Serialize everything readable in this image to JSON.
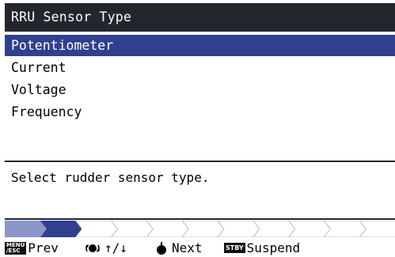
{
  "title": "RRU Sensor Type",
  "options": [
    {
      "label": "Potentiometer",
      "selected": true
    },
    {
      "label": "Current",
      "selected": false
    },
    {
      "label": "Voltage",
      "selected": false
    },
    {
      "label": "Frequency",
      "selected": false
    }
  ],
  "message": "Select rudder sensor type.",
  "progress": {
    "total_steps": 11,
    "current_step": 2
  },
  "footer": {
    "menu_badge_top": "MENU",
    "menu_badge_bottom": "/ESC",
    "prev_label": "Prev",
    "knob_label": "↑/↓",
    "next_label": "Next",
    "stby_badge": "STBY",
    "suspend_label": "Suspend"
  },
  "colors": {
    "title_bar": "#23262d",
    "selection": "#30408e",
    "progress_done_dark": "#30408e",
    "progress_done_light": "#8c95c8",
    "progress_outline": "#bfc3cc"
  }
}
